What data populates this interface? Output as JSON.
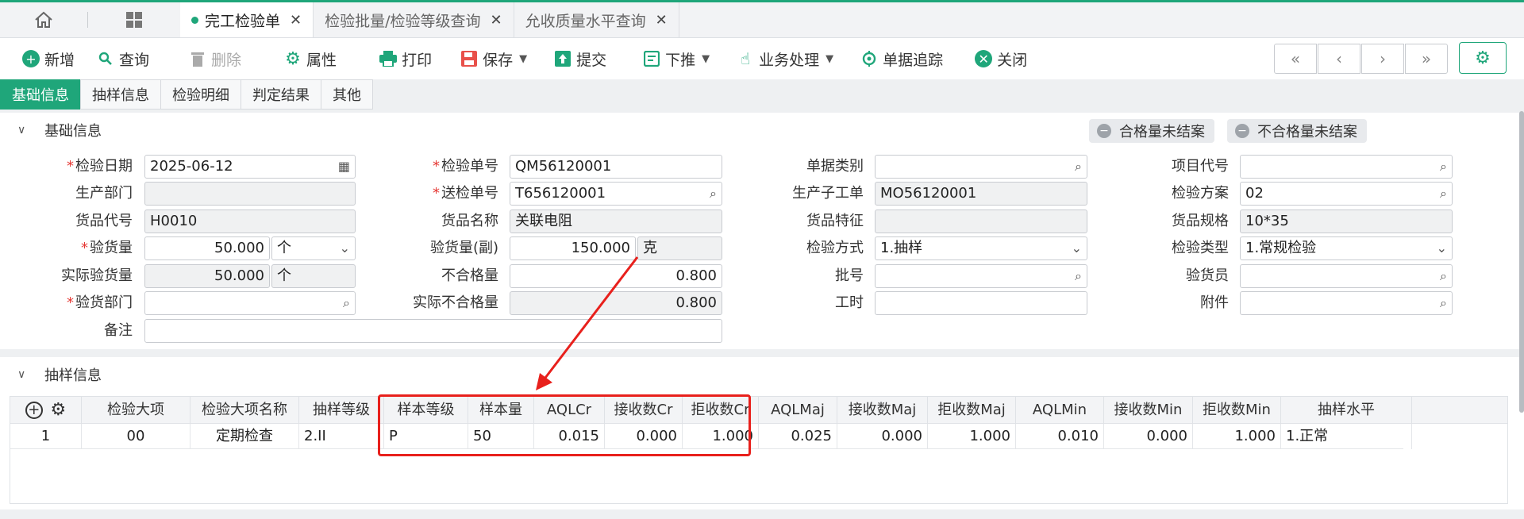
{
  "tabs": [
    {
      "label": "完工检验单",
      "active": true
    },
    {
      "label": "检验批量/检验等级查询",
      "active": false
    },
    {
      "label": "允收质量水平查询",
      "active": false
    }
  ],
  "toolbar": {
    "new": "新增",
    "query": "查询",
    "delete": "删除",
    "props": "属性",
    "print": "打印",
    "save": "保存",
    "submit": "提交",
    "push": "下推",
    "biz": "业务处理",
    "track": "单据追踪",
    "close": "关闭"
  },
  "subtabs": [
    "基础信息",
    "抽样信息",
    "检验明细",
    "判定结果",
    "其他"
  ],
  "basic": {
    "title": "基础信息",
    "pill_pass": "合格量未结案",
    "pill_fail": "不合格量未结案",
    "labels": {
      "check_date": "检验日期",
      "prod_dept": "生产部门",
      "item_code": "货品代号",
      "check_qty": "验货量",
      "actual_qty": "实际验货量",
      "check_dept": "验货部门",
      "remark": "备注",
      "check_no": "检验单号",
      "send_no": "送检单号",
      "item_name": "货品名称",
      "check_qty2": "验货量(副)",
      "ng_qty": "不合格量",
      "actual_ng_qty": "实际不合格量",
      "doc_type": "单据类别",
      "sub_wo": "生产子工单",
      "item_feature": "货品特征",
      "check_method": "检验方式",
      "batch_no": "批号",
      "work_hours": "工时",
      "project_code": "项目代号",
      "check_plan": "检验方案",
      "item_spec": "货品规格",
      "check_type": "检验类型",
      "inspector": "验货员",
      "attachment": "附件"
    },
    "values": {
      "check_date": "2025-06-12",
      "prod_dept": "",
      "item_code": "H0010",
      "check_qty": "50.000",
      "check_qty_unit": "个",
      "actual_qty": "50.000",
      "actual_qty_unit": "个",
      "check_dept": "",
      "remark": "",
      "check_no": "QM56120001",
      "send_no": "T656120001",
      "item_name": "关联电阻",
      "check_qty2": "150.000",
      "check_qty2_unit": "克",
      "ng_qty": "0.800",
      "actual_ng_qty": "0.800",
      "doc_type": "",
      "sub_wo": "MO56120001",
      "item_feature": "",
      "check_method": "1.抽样",
      "batch_no": "",
      "work_hours": "",
      "project_code": "",
      "check_plan": "02",
      "item_spec": "10*35",
      "check_type": "1.常规检验",
      "inspector": "",
      "attachment": ""
    }
  },
  "sampling": {
    "title": "抽样信息",
    "columns": [
      "检验大项",
      "检验大项名称",
      "抽样等级",
      "样本等级",
      "样本量",
      "AQLCr",
      "接收数Cr",
      "拒收数Cr",
      "AQLMaj",
      "接收数Maj",
      "拒收数Maj",
      "AQLMin",
      "接收数Min",
      "拒收数Min",
      "抽样水平"
    ],
    "rows": [
      [
        "1",
        "00",
        "定期检查",
        "2.II",
        "P",
        "50",
        "0.015",
        "0.000",
        "1.000",
        "0.025",
        "0.000",
        "1.000",
        "0.010",
        "0.000",
        "1.000",
        "1.正常"
      ]
    ]
  }
}
